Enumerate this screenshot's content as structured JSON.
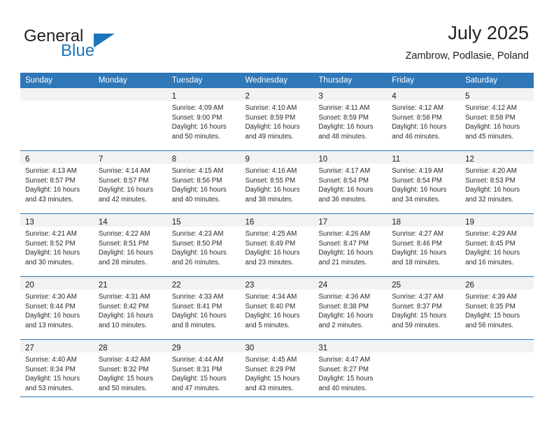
{
  "brand": {
    "name_top": "General",
    "name_bottom": "Blue",
    "accent_color": "#1b75bb",
    "logo_icon": "triangle-flag-icon"
  },
  "header": {
    "title": "July 2025",
    "subtitle": "Zambrow, Podlasie, Poland"
  },
  "calendar": {
    "header_color": "#2f77b7",
    "daynum_strip_color": "#f2f2f2",
    "weekday_headers": [
      "Sunday",
      "Monday",
      "Tuesday",
      "Wednesday",
      "Thursday",
      "Friday",
      "Saturday"
    ],
    "weeks": [
      [
        {
          "day": "",
          "sunrise": "",
          "sunset": "",
          "daylight": ""
        },
        {
          "day": "",
          "sunrise": "",
          "sunset": "",
          "daylight": ""
        },
        {
          "day": "1",
          "sunrise": "Sunrise: 4:09 AM",
          "sunset": "Sunset: 9:00 PM",
          "daylight": "Daylight: 16 hours and 50 minutes."
        },
        {
          "day": "2",
          "sunrise": "Sunrise: 4:10 AM",
          "sunset": "Sunset: 8:59 PM",
          "daylight": "Daylight: 16 hours and 49 minutes."
        },
        {
          "day": "3",
          "sunrise": "Sunrise: 4:11 AM",
          "sunset": "Sunset: 8:59 PM",
          "daylight": "Daylight: 16 hours and 48 minutes."
        },
        {
          "day": "4",
          "sunrise": "Sunrise: 4:12 AM",
          "sunset": "Sunset: 8:58 PM",
          "daylight": "Daylight: 16 hours and 46 minutes."
        },
        {
          "day": "5",
          "sunrise": "Sunrise: 4:12 AM",
          "sunset": "Sunset: 8:58 PM",
          "daylight": "Daylight: 16 hours and 45 minutes."
        }
      ],
      [
        {
          "day": "6",
          "sunrise": "Sunrise: 4:13 AM",
          "sunset": "Sunset: 8:57 PM",
          "daylight": "Daylight: 16 hours and 43 minutes."
        },
        {
          "day": "7",
          "sunrise": "Sunrise: 4:14 AM",
          "sunset": "Sunset: 8:57 PM",
          "daylight": "Daylight: 16 hours and 42 minutes."
        },
        {
          "day": "8",
          "sunrise": "Sunrise: 4:15 AM",
          "sunset": "Sunset: 8:56 PM",
          "daylight": "Daylight: 16 hours and 40 minutes."
        },
        {
          "day": "9",
          "sunrise": "Sunrise: 4:16 AM",
          "sunset": "Sunset: 8:55 PM",
          "daylight": "Daylight: 16 hours and 38 minutes."
        },
        {
          "day": "10",
          "sunrise": "Sunrise: 4:17 AM",
          "sunset": "Sunset: 8:54 PM",
          "daylight": "Daylight: 16 hours and 36 minutes."
        },
        {
          "day": "11",
          "sunrise": "Sunrise: 4:19 AM",
          "sunset": "Sunset: 8:54 PM",
          "daylight": "Daylight: 16 hours and 34 minutes."
        },
        {
          "day": "12",
          "sunrise": "Sunrise: 4:20 AM",
          "sunset": "Sunset: 8:53 PM",
          "daylight": "Daylight: 16 hours and 32 minutes."
        }
      ],
      [
        {
          "day": "13",
          "sunrise": "Sunrise: 4:21 AM",
          "sunset": "Sunset: 8:52 PM",
          "daylight": "Daylight: 16 hours and 30 minutes."
        },
        {
          "day": "14",
          "sunrise": "Sunrise: 4:22 AM",
          "sunset": "Sunset: 8:51 PM",
          "daylight": "Daylight: 16 hours and 28 minutes."
        },
        {
          "day": "15",
          "sunrise": "Sunrise: 4:23 AM",
          "sunset": "Sunset: 8:50 PM",
          "daylight": "Daylight: 16 hours and 26 minutes."
        },
        {
          "day": "16",
          "sunrise": "Sunrise: 4:25 AM",
          "sunset": "Sunset: 8:49 PM",
          "daylight": "Daylight: 16 hours and 23 minutes."
        },
        {
          "day": "17",
          "sunrise": "Sunrise: 4:26 AM",
          "sunset": "Sunset: 8:47 PM",
          "daylight": "Daylight: 16 hours and 21 minutes."
        },
        {
          "day": "18",
          "sunrise": "Sunrise: 4:27 AM",
          "sunset": "Sunset: 8:46 PM",
          "daylight": "Daylight: 16 hours and 18 minutes."
        },
        {
          "day": "19",
          "sunrise": "Sunrise: 4:29 AM",
          "sunset": "Sunset: 8:45 PM",
          "daylight": "Daylight: 16 hours and 16 minutes."
        }
      ],
      [
        {
          "day": "20",
          "sunrise": "Sunrise: 4:30 AM",
          "sunset": "Sunset: 8:44 PM",
          "daylight": "Daylight: 16 hours and 13 minutes."
        },
        {
          "day": "21",
          "sunrise": "Sunrise: 4:31 AM",
          "sunset": "Sunset: 8:42 PM",
          "daylight": "Daylight: 16 hours and 10 minutes."
        },
        {
          "day": "22",
          "sunrise": "Sunrise: 4:33 AM",
          "sunset": "Sunset: 8:41 PM",
          "daylight": "Daylight: 16 hours and 8 minutes."
        },
        {
          "day": "23",
          "sunrise": "Sunrise: 4:34 AM",
          "sunset": "Sunset: 8:40 PM",
          "daylight": "Daylight: 16 hours and 5 minutes."
        },
        {
          "day": "24",
          "sunrise": "Sunrise: 4:36 AM",
          "sunset": "Sunset: 8:38 PM",
          "daylight": "Daylight: 16 hours and 2 minutes."
        },
        {
          "day": "25",
          "sunrise": "Sunrise: 4:37 AM",
          "sunset": "Sunset: 8:37 PM",
          "daylight": "Daylight: 15 hours and 59 minutes."
        },
        {
          "day": "26",
          "sunrise": "Sunrise: 4:39 AM",
          "sunset": "Sunset: 8:35 PM",
          "daylight": "Daylight: 15 hours and 56 minutes."
        }
      ],
      [
        {
          "day": "27",
          "sunrise": "Sunrise: 4:40 AM",
          "sunset": "Sunset: 8:34 PM",
          "daylight": "Daylight: 15 hours and 53 minutes."
        },
        {
          "day": "28",
          "sunrise": "Sunrise: 4:42 AM",
          "sunset": "Sunset: 8:32 PM",
          "daylight": "Daylight: 15 hours and 50 minutes."
        },
        {
          "day": "29",
          "sunrise": "Sunrise: 4:44 AM",
          "sunset": "Sunset: 8:31 PM",
          "daylight": "Daylight: 15 hours and 47 minutes."
        },
        {
          "day": "30",
          "sunrise": "Sunrise: 4:45 AM",
          "sunset": "Sunset: 8:29 PM",
          "daylight": "Daylight: 15 hours and 43 minutes."
        },
        {
          "day": "31",
          "sunrise": "Sunrise: 4:47 AM",
          "sunset": "Sunset: 8:27 PM",
          "daylight": "Daylight: 15 hours and 40 minutes."
        },
        {
          "day": "",
          "sunrise": "",
          "sunset": "",
          "daylight": ""
        },
        {
          "day": "",
          "sunrise": "",
          "sunset": "",
          "daylight": ""
        }
      ]
    ]
  }
}
